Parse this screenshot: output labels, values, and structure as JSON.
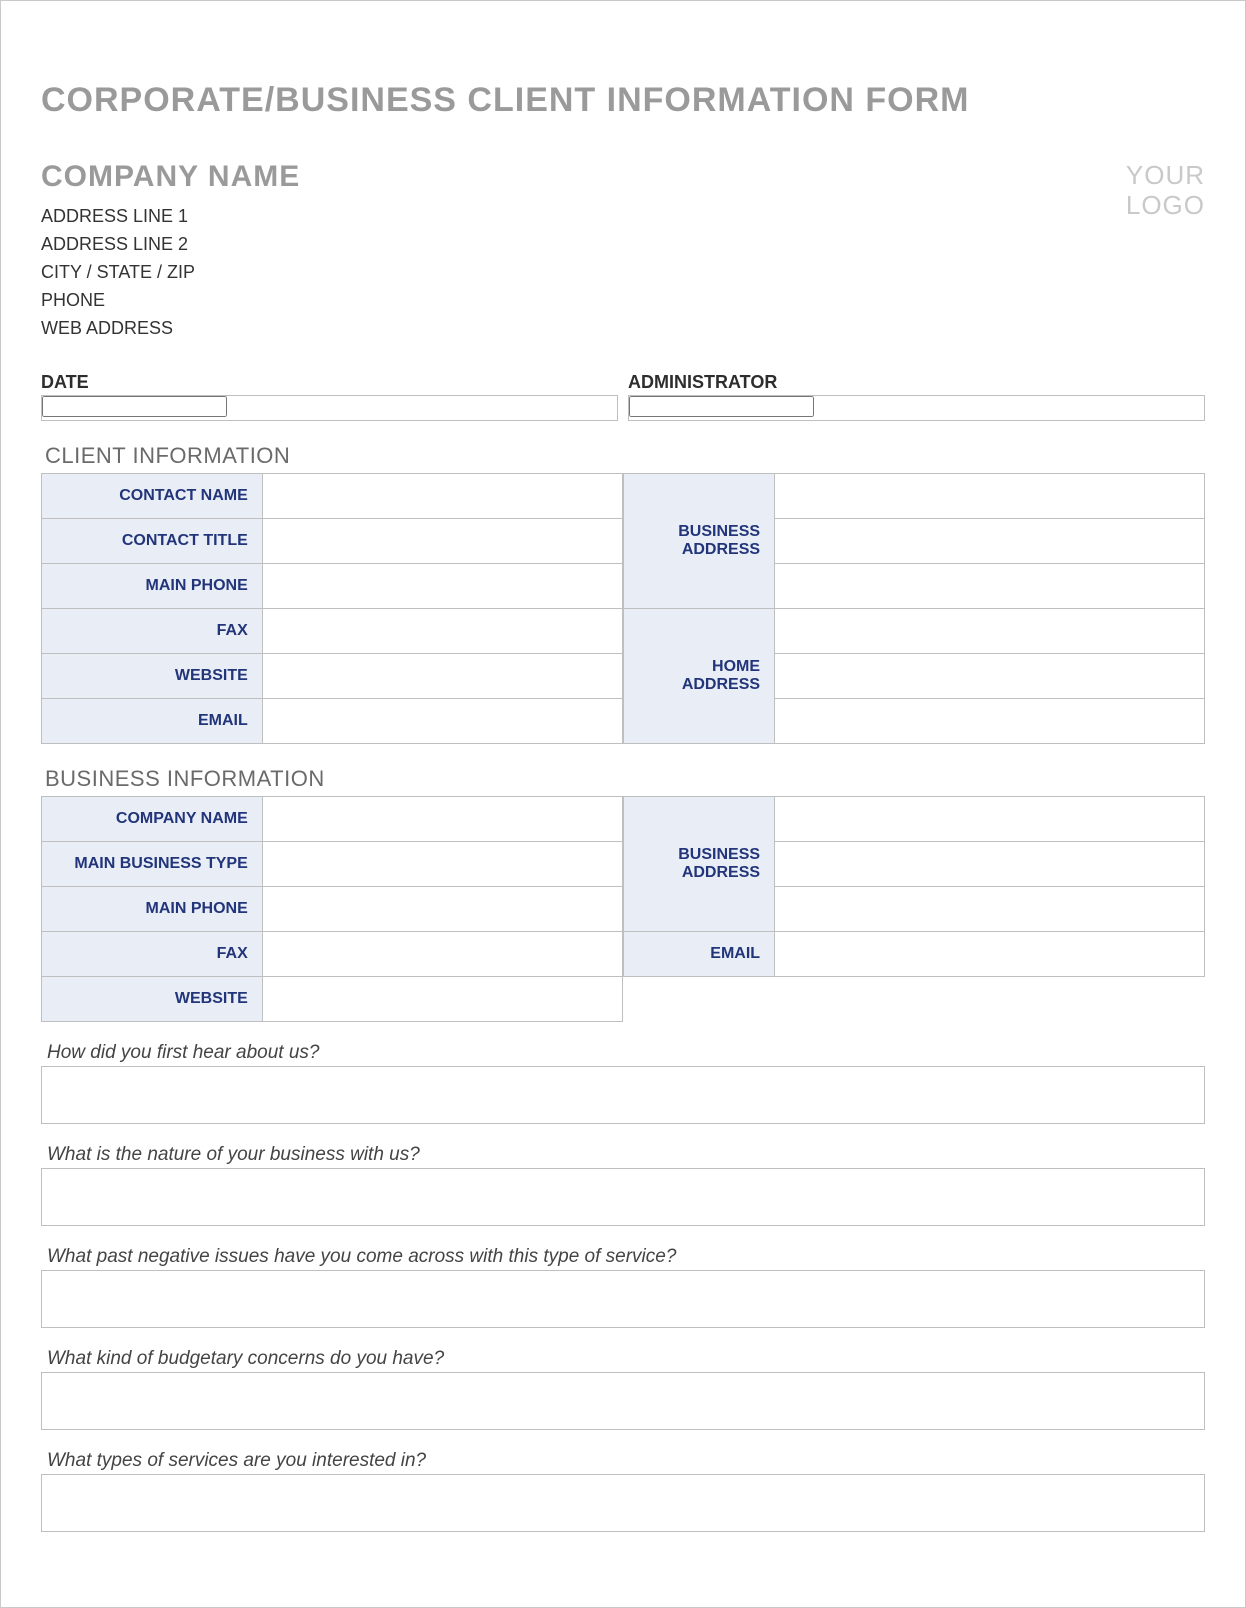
{
  "title": "CORPORATE/BUSINESS CLIENT INFORMATION FORM",
  "company_name": "COMPANY NAME",
  "addr1": "ADDRESS LINE 1",
  "addr2": "ADDRESS LINE 2",
  "city": "CITY / STATE / ZIP",
  "phone": "PHONE",
  "web": "WEB ADDRESS",
  "logo1": "YOUR",
  "logo2": "LOGO",
  "date_lbl": "DATE",
  "admin_lbl": "ADMINISTRATOR",
  "section_client": "CLIENT INFORMATION",
  "client": {
    "contact_name": "CONTACT NAME",
    "contact_title": "CONTACT TITLE",
    "main_phone": "MAIN PHONE",
    "fax": "FAX",
    "website": "WEBSITE",
    "email": "EMAIL",
    "business_address": "BUSINESS ADDRESS",
    "home_address": "HOME ADDRESS"
  },
  "section_business": "BUSINESS INFORMATION",
  "business": {
    "company_name": "COMPANY NAME",
    "main_business_type": "MAIN BUSINESS TYPE",
    "main_phone": "MAIN PHONE",
    "fax": "FAX",
    "website": "WEBSITE",
    "business_address": "BUSINESS ADDRESS",
    "email": "EMAIL"
  },
  "q1": "How did you first hear about us?",
  "q2": "What is the nature of your business with us?",
  "q3": "What past negative issues have you come across with this type of service?",
  "q4": "What kind of budgetary concerns do you have?",
  "q5": "What types of services are you interested in?"
}
